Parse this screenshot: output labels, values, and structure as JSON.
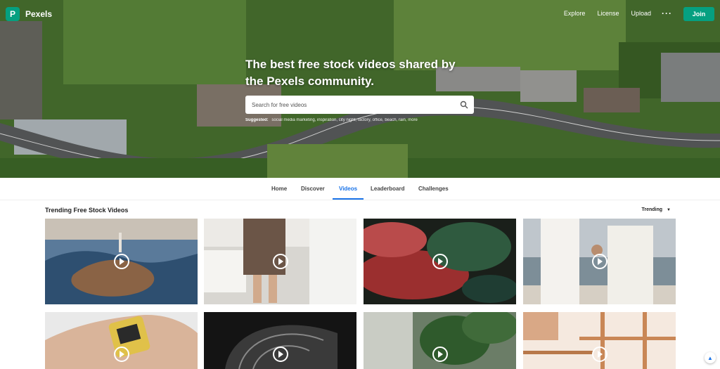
{
  "brand": {
    "name": "Pexels",
    "accent": "#05a081"
  },
  "nav": {
    "links": [
      "Explore",
      "License",
      "Upload"
    ],
    "more_icon": "more-dots-icon",
    "join_label": "Join"
  },
  "hero": {
    "headline": "The best free stock videos shared by the Pexels community.",
    "search_placeholder": "Search for free videos",
    "suggested_label": "Suggested:",
    "suggested_items": "social media marketing, inspiration, city night, factory, office, beach, rain, more"
  },
  "tabs": {
    "items": [
      "Home",
      "Discover",
      "Videos",
      "Leaderboard",
      "Challenges"
    ],
    "active": "Videos",
    "active_color": "#1a73e8"
  },
  "section": {
    "title": "Trending Free Stock Videos",
    "sort_label": "Trending"
  },
  "videos": [
    {
      "subject": "aerial coastline with lighthouse",
      "icon": "play-icon"
    },
    {
      "subject": "person standing in white kitchen",
      "icon": "play-icon"
    },
    {
      "subject": "red and green colored smoke",
      "icon": "play-icon"
    },
    {
      "subject": "couple holding hands at the beach",
      "icon": "play-icon"
    },
    {
      "subject": "hand holding film canister",
      "icon": "play-icon"
    },
    {
      "subject": "ornate iron window at night",
      "icon": "play-icon"
    },
    {
      "subject": "green plants close up",
      "icon": "play-icon"
    },
    {
      "subject": "orange lamp and metal frame",
      "icon": "play-icon"
    }
  ]
}
